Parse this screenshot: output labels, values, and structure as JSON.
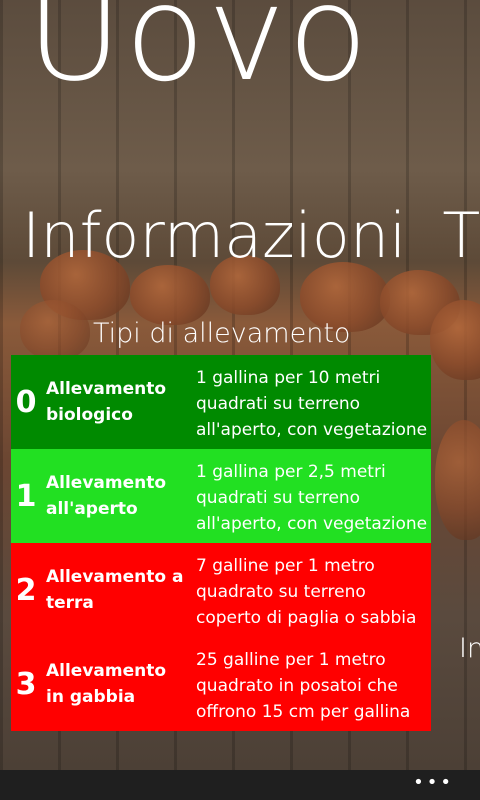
{
  "app": {
    "title": "Uovo"
  },
  "pivot": {
    "items": [
      "Informazioni",
      "T"
    ]
  },
  "section": {
    "title": "Tipi di allevamento",
    "types": [
      {
        "number": "0",
        "name": "Allevamento biologico",
        "description": "1 gallina per 10 metri quadrati su terreno all'aperto, con vegetazione",
        "color": "#008a00"
      },
      {
        "number": "1",
        "name": "Allevamento all'aperto",
        "description": "1 gallina per 2,5 metri quadrati su terreno all'aperto, con vegetazione",
        "color": "#22e022"
      },
      {
        "number": "2",
        "name": "Allevamento a terra",
        "description": "7 galline per 1 metro quadrato su terreno coperto di paglia o sabbia",
        "color": "#ff0000"
      },
      {
        "number": "3",
        "name": "Allevamento in gabbia",
        "description": "25 galline per 1 metro quadrato in posatoi che offrono 15 cm per gallina",
        "color": "#ff0000"
      }
    ]
  },
  "next_panel_peek": "In",
  "appbar": {
    "more_icon": "ellipsis-icon",
    "more_glyph": "•••"
  }
}
